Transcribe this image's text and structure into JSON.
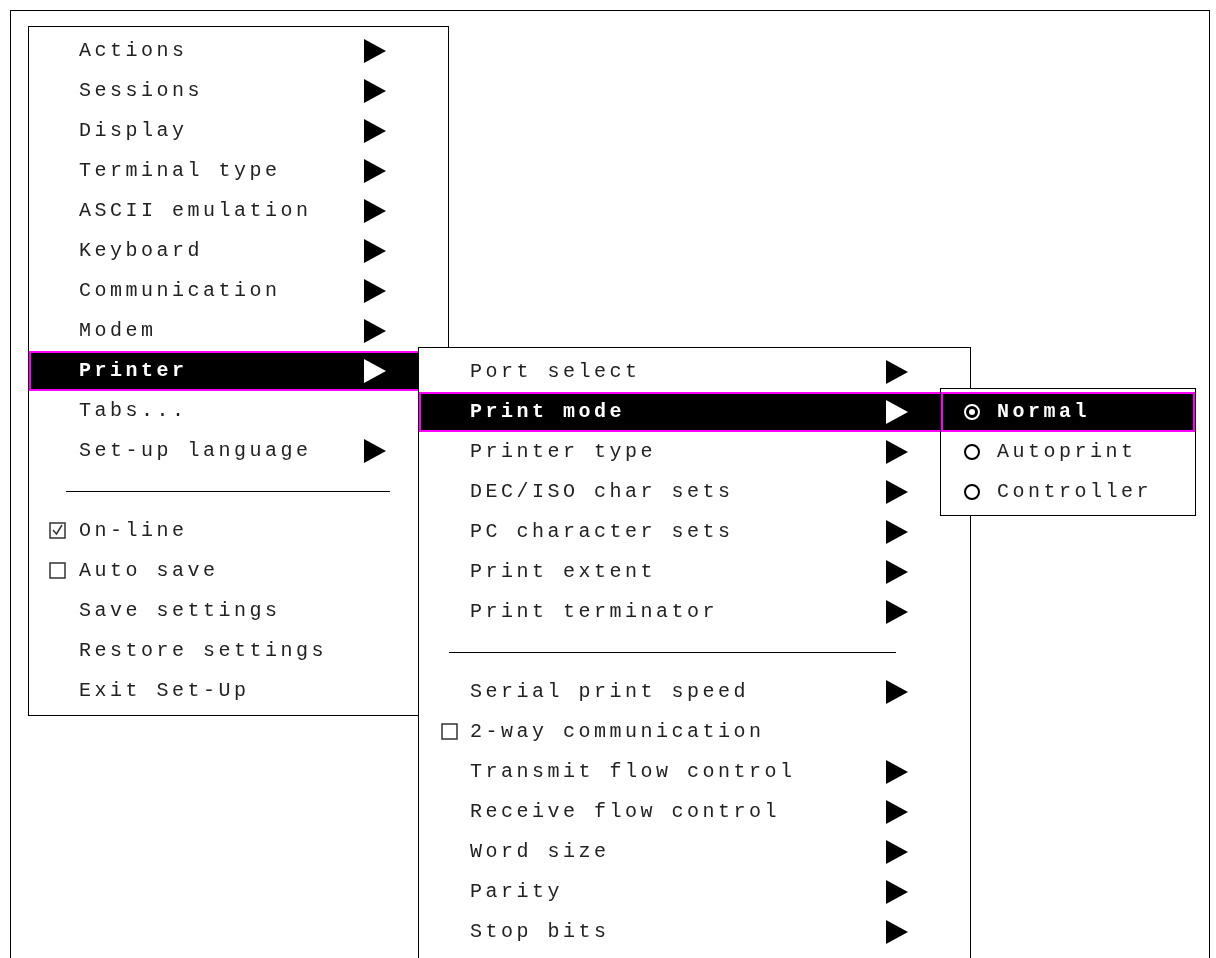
{
  "menus": [
    {
      "items": [
        {
          "kind": "submenu",
          "label": "Actions",
          "selected": false
        },
        {
          "kind": "submenu",
          "label": "Sessions",
          "selected": false
        },
        {
          "kind": "submenu",
          "label": "Display",
          "selected": false
        },
        {
          "kind": "submenu",
          "label": "Terminal type",
          "selected": false
        },
        {
          "kind": "submenu",
          "label": "ASCII emulation",
          "selected": false
        },
        {
          "kind": "submenu",
          "label": "Keyboard",
          "selected": false
        },
        {
          "kind": "submenu",
          "label": "Communication",
          "selected": false
        },
        {
          "kind": "submenu",
          "label": "Modem",
          "selected": false
        },
        {
          "kind": "submenu",
          "label": "Printer",
          "selected": true
        },
        {
          "kind": "command",
          "label": "Tabs...",
          "selected": false
        },
        {
          "kind": "submenu",
          "label": "Set-up language",
          "selected": false
        },
        {
          "kind": "separator"
        },
        {
          "kind": "checkbox",
          "label": "On-line",
          "checked": true,
          "selected": false
        },
        {
          "kind": "checkbox",
          "label": "Auto save",
          "checked": false,
          "selected": false
        },
        {
          "kind": "command",
          "label": "Save settings",
          "selected": false
        },
        {
          "kind": "command",
          "label": "Restore settings",
          "selected": false
        },
        {
          "kind": "command",
          "label": "Exit Set-Up",
          "selected": false
        }
      ]
    },
    {
      "items": [
        {
          "kind": "submenu",
          "label": "Port select",
          "selected": false
        },
        {
          "kind": "submenu",
          "label": "Print mode",
          "selected": true
        },
        {
          "kind": "submenu",
          "label": "Printer type",
          "selected": false
        },
        {
          "kind": "submenu",
          "label": "DEC/ISO char sets",
          "selected": false
        },
        {
          "kind": "submenu",
          "label": "PC character sets",
          "selected": false
        },
        {
          "kind": "submenu",
          "label": "Print extent",
          "selected": false
        },
        {
          "kind": "submenu",
          "label": "Print terminator",
          "selected": false
        },
        {
          "kind": "separator"
        },
        {
          "kind": "submenu",
          "label": "Serial print speed",
          "selected": false
        },
        {
          "kind": "checkbox",
          "label": "2-way communication",
          "checked": false,
          "selected": false
        },
        {
          "kind": "submenu",
          "label": "Transmit flow control",
          "selected": false
        },
        {
          "kind": "submenu",
          "label": "Receive flow control",
          "selected": false
        },
        {
          "kind": "submenu",
          "label": "Word size",
          "selected": false
        },
        {
          "kind": "submenu",
          "label": "Parity",
          "selected": false
        },
        {
          "kind": "submenu",
          "label": "Stop bits",
          "selected": false
        }
      ]
    },
    {
      "items": [
        {
          "kind": "radio",
          "label": "Normal",
          "selected": true
        },
        {
          "kind": "radio",
          "label": "Autoprint",
          "selected": false
        },
        {
          "kind": "radio",
          "label": "Controller",
          "selected": false
        }
      ]
    }
  ]
}
